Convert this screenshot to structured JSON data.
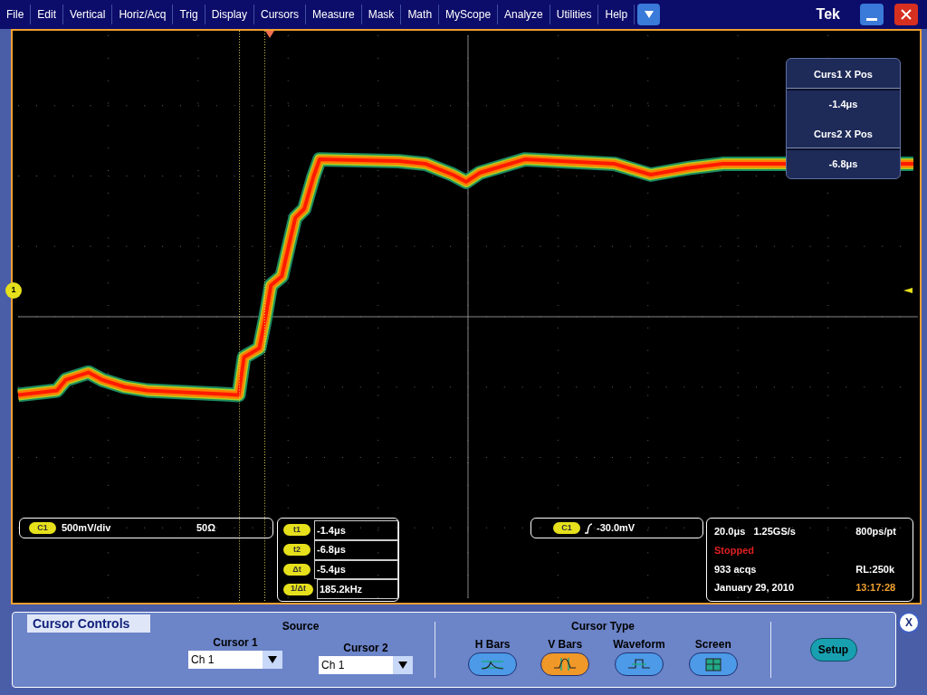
{
  "menu": {
    "items": [
      "File",
      "Edit",
      "Vertical",
      "Horiz/Acq",
      "Trig",
      "Display",
      "Cursors",
      "Measure",
      "Mask",
      "Math",
      "MyScope",
      "Analyze",
      "Utilities",
      "Help"
    ],
    "logo": "Tek"
  },
  "channel_marker": "1",
  "channel_readout": {
    "badge": "C1",
    "scale": "500mV/div",
    "impedance": "50Ω"
  },
  "cursor_readouts": [
    {
      "badge": "t1",
      "value": "-1.4μs"
    },
    {
      "badge": "t2",
      "value": "-6.8μs"
    },
    {
      "badge": "Δt",
      "value": "-5.4μs"
    },
    {
      "badge": "1/Δt",
      "value": "185.2kHz"
    }
  ],
  "trigger": {
    "badge": "C1",
    "level": "-30.0mV"
  },
  "acquisition": {
    "timebase": "20.0μs",
    "sample_rate": "1.25GS/s",
    "resolution": "800ps/pt",
    "status": "Stopped",
    "acqs": "933 acqs",
    "record_length": "RL:250k",
    "date": "January 29, 2010",
    "time": "13:17:28"
  },
  "cursor_popup": [
    {
      "label": "Curs1 X Pos",
      "value": "-1.4μs"
    },
    {
      "label": "Curs2 X Pos",
      "value": "-6.8μs"
    }
  ],
  "cursor_controls": {
    "title": "Cursor Controls",
    "source_label": "Source",
    "sources": [
      {
        "label": "Cursor 1",
        "value": "Ch 1"
      },
      {
        "label": "Cursor 2",
        "value": "Ch 1"
      }
    ],
    "type_label": "Cursor Type",
    "types": [
      {
        "label": "H Bars",
        "kind": "hbars",
        "selected": false
      },
      {
        "label": "V Bars",
        "kind": "vbars",
        "selected": true
      },
      {
        "label": "Waveform",
        "kind": "waveform",
        "selected": false
      },
      {
        "label": "Screen",
        "kind": "screen",
        "selected": false
      }
    ],
    "setup": "Setup",
    "close": "X"
  }
}
